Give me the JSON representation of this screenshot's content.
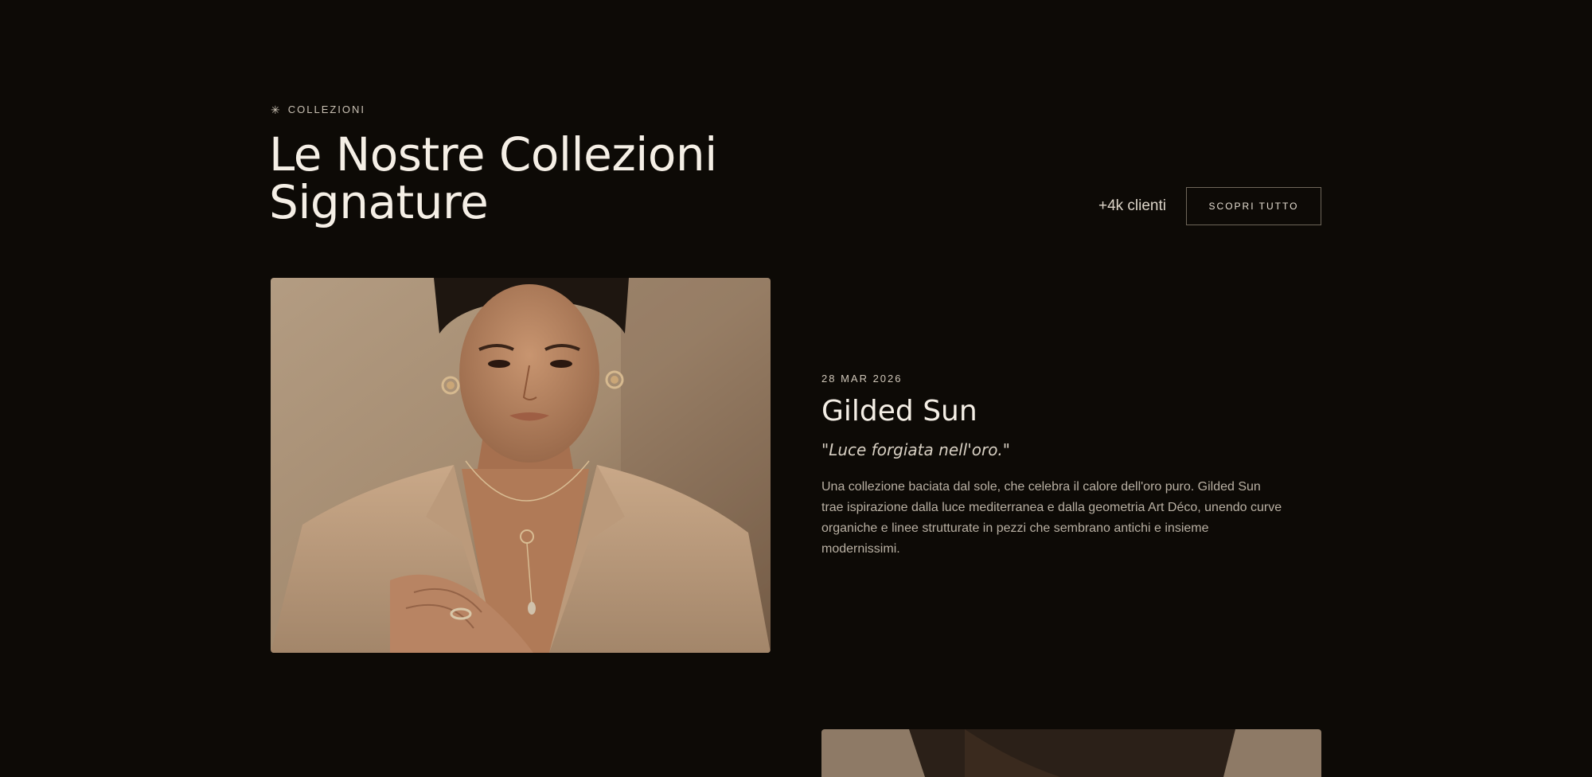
{
  "section": {
    "eyebrow": "COLLEZIONI",
    "eyebrow_icon": "sparkle-icon",
    "title_line1": "Le Nostre Collezioni",
    "title_line2": "Signature"
  },
  "header_actions": {
    "client_count": "+4k clienti",
    "button_label": "SCOPRI TUTTO"
  },
  "collection": {
    "date": "28 MAR 2026",
    "title": "Gilded Sun",
    "tagline": "\"Luce forgiata nell'oro.\"",
    "description": "Una collezione baciata dal sole, che celebra il calore dell'oro puro. Gilded Sun trae ispirazione dalla luce mediterranea e dalla geometria Art Déco, unendo curve organiche e linee strutturate in pezzi che sembrano antichi e insieme modernissimi."
  },
  "colors": {
    "background": "#0d0a06",
    "text_primary": "#f5efe6",
    "text_muted": "#b9b0a3",
    "button_border": "#6e6659"
  }
}
